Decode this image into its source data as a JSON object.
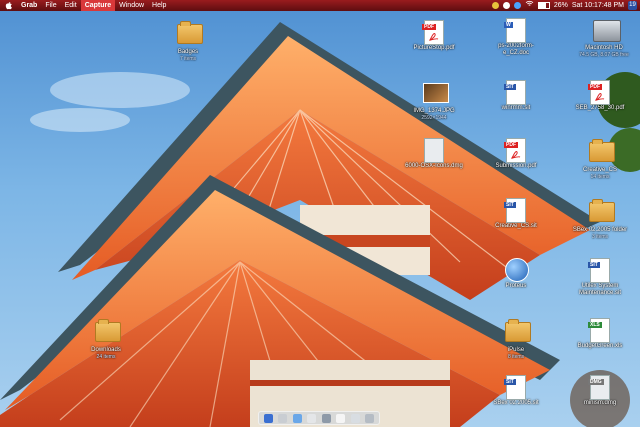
{
  "menubar": {
    "app_name": "Grab",
    "items": [
      "File",
      "Edit",
      "Capture",
      "Window",
      "Help"
    ],
    "active_item": "Capture",
    "clock": "Sat 10:17:48 PM",
    "battery_percent": "26%",
    "spotlight_label": "19"
  },
  "desktop": {
    "icons": [
      {
        "name": "Badges",
        "sub": "7 items",
        "kind": "folder"
      },
      {
        "name": "PictureStop.pdf",
        "sub": "",
        "kind": "pdf"
      },
      {
        "name": "ps-2002form-e_CZ.doc",
        "sub": "",
        "kind": "doc"
      },
      {
        "name": "Macintosh HD",
        "sub": "74.5 GB, 8.07 GB free",
        "kind": "hd"
      },
      {
        "name": "IMG_1374.JPG",
        "sub": "2592×1944",
        "kind": "photo"
      },
      {
        "name": "winrmm.sit",
        "sub": "",
        "kind": "sit"
      },
      {
        "name": "SEB_2758_30.pdf",
        "sub": "",
        "kind": "pdf"
      },
      {
        "name": "6000-OSX-Icons.dmg",
        "sub": "",
        "kind": "dmg"
      },
      {
        "name": "Submission.pdf",
        "sub": "",
        "kind": "pdf"
      },
      {
        "name": "Creative_CS",
        "sub": "14 items",
        "kind": "folder"
      },
      {
        "name": "Creative_CS.sit",
        "sub": "",
        "kind": "sit"
      },
      {
        "name": "SBex 02.2005 folder",
        "sub": "3 items",
        "kind": "folder"
      },
      {
        "name": "Proteus",
        "sub": "",
        "kind": "app"
      },
      {
        "name": "Utilex System Maintenance.sit",
        "sub": "",
        "kind": "sit"
      },
      {
        "name": "iPulse",
        "sub": "8 items",
        "kind": "folder"
      },
      {
        "name": "BudgetGreen.xls",
        "sub": "",
        "kind": "xls"
      },
      {
        "name": "Downloads",
        "sub": "24 items",
        "kind": "folder"
      },
      {
        "name": "SBex 02.2005.sit",
        "sub": "",
        "kind": "sit"
      },
      {
        "name": "minism.dmg",
        "sub": "",
        "kind": "dmg"
      }
    ]
  },
  "colors": {
    "menubar": "#7a1416",
    "menu_active": "#d9383a",
    "roof": "#e2572a",
    "sky": "#6aa6dd"
  },
  "icon_names": [
    "apple-icon",
    "folder-icon",
    "pdf-icon",
    "sit-icon",
    "dmg-icon",
    "hard-drive-icon",
    "globe-icon",
    "wifi-icon",
    "battery-icon",
    "spotlight-icon"
  ]
}
